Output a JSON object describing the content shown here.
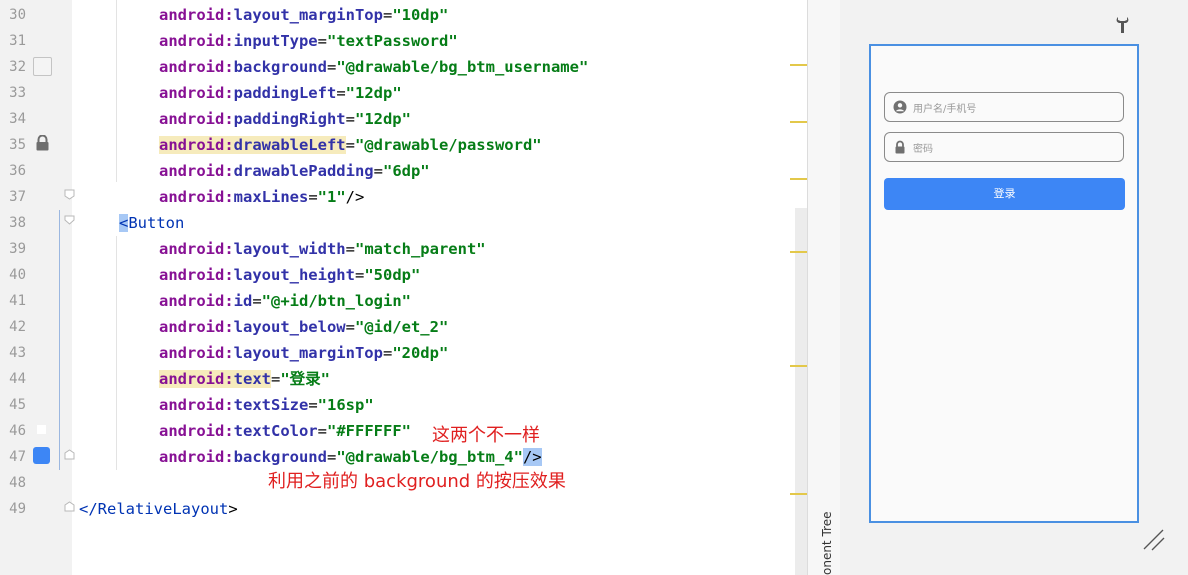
{
  "editor": {
    "lines": [
      {
        "num": "30",
        "indent": 2,
        "parts": [
          [
            "k",
            "android:"
          ],
          [
            "k2",
            "layout_marginTop"
          ],
          [
            "punc",
            "="
          ],
          [
            "v",
            "\"10dp\""
          ]
        ]
      },
      {
        "num": "31",
        "indent": 2,
        "parts": [
          [
            "k",
            "android:"
          ],
          [
            "k2",
            "inputType"
          ],
          [
            "punc",
            "="
          ],
          [
            "v",
            "\"textPassword\""
          ]
        ]
      },
      {
        "num": "32",
        "indent": 2,
        "parts": [
          [
            "k",
            "android:"
          ],
          [
            "k2",
            "background"
          ],
          [
            "punc",
            "="
          ],
          [
            "v",
            "\"@drawable/bg_btm_username\""
          ]
        ]
      },
      {
        "num": "33",
        "indent": 2,
        "parts": [
          [
            "k",
            "android:"
          ],
          [
            "k2",
            "paddingLeft"
          ],
          [
            "punc",
            "="
          ],
          [
            "v",
            "\"12dp\""
          ]
        ]
      },
      {
        "num": "34",
        "indent": 2,
        "parts": [
          [
            "k",
            "android:"
          ],
          [
            "k2",
            "paddingRight"
          ],
          [
            "punc",
            "="
          ],
          [
            "v",
            "\"12dp\""
          ]
        ]
      },
      {
        "num": "35",
        "indent": 2,
        "hl": true,
        "parts": [
          [
            "k",
            "android:"
          ],
          [
            "k2",
            "drawableLeft"
          ],
          [
            "punc",
            "="
          ],
          [
            "v",
            "\"@drawable/password\""
          ]
        ]
      },
      {
        "num": "36",
        "indent": 2,
        "parts": [
          [
            "k",
            "android:"
          ],
          [
            "k2",
            "drawablePadding"
          ],
          [
            "punc",
            "="
          ],
          [
            "v",
            "\"6dp\""
          ]
        ]
      },
      {
        "num": "37",
        "indent": 2,
        "parts": [
          [
            "k",
            "android:"
          ],
          [
            "k2",
            "maxLines"
          ],
          [
            "punc",
            "="
          ],
          [
            "v",
            "\"1\""
          ],
          [
            "punc",
            "/>"
          ]
        ]
      },
      {
        "num": "38",
        "indent": 1,
        "parts": [
          [
            "tag",
            "<Button"
          ]
        ]
      },
      {
        "num": "39",
        "indent": 2,
        "parts": [
          [
            "k",
            "android:"
          ],
          [
            "k2",
            "layout_width"
          ],
          [
            "punc",
            "="
          ],
          [
            "v",
            "\"match_parent\""
          ]
        ]
      },
      {
        "num": "40",
        "indent": 2,
        "parts": [
          [
            "k",
            "android:"
          ],
          [
            "k2",
            "layout_height"
          ],
          [
            "punc",
            "="
          ],
          [
            "v",
            "\"50dp\""
          ]
        ]
      },
      {
        "num": "41",
        "indent": 2,
        "parts": [
          [
            "k",
            "android:"
          ],
          [
            "k2",
            "id"
          ],
          [
            "punc",
            "="
          ],
          [
            "v",
            "\"@+id/btn_login\""
          ]
        ]
      },
      {
        "num": "42",
        "indent": 2,
        "parts": [
          [
            "k",
            "android:"
          ],
          [
            "k2",
            "layout_below"
          ],
          [
            "punc",
            "="
          ],
          [
            "v",
            "\"@id/et_2\""
          ]
        ]
      },
      {
        "num": "43",
        "indent": 2,
        "parts": [
          [
            "k",
            "android:"
          ],
          [
            "k2",
            "layout_marginTop"
          ],
          [
            "punc",
            "="
          ],
          [
            "v",
            "\"20dp\""
          ]
        ]
      },
      {
        "num": "44",
        "indent": 2,
        "hl": true,
        "parts": [
          [
            "k",
            "android:"
          ],
          [
            "k2",
            "text"
          ],
          [
            "punc",
            "="
          ],
          [
            "v",
            "\"登录\""
          ]
        ]
      },
      {
        "num": "45",
        "indent": 2,
        "parts": [
          [
            "k",
            "android:"
          ],
          [
            "k2",
            "textSize"
          ],
          [
            "punc",
            "="
          ],
          [
            "v",
            "\"16sp\""
          ]
        ]
      },
      {
        "num": "46",
        "indent": 2,
        "parts": [
          [
            "k",
            "android:"
          ],
          [
            "k2",
            "textColor"
          ],
          [
            "punc",
            "="
          ],
          [
            "v",
            "\"#FFFFFF\""
          ]
        ]
      },
      {
        "num": "47",
        "indent": 2,
        "parts": [
          [
            "k",
            "android:"
          ],
          [
            "k2",
            "background"
          ],
          [
            "punc",
            "="
          ],
          [
            "v",
            "\"@drawable/bg_btm_4\""
          ],
          [
            "punc",
            "/>"
          ]
        ]
      },
      {
        "num": "48",
        "indent": 0,
        "parts": []
      },
      {
        "num": "49",
        "indent": 0,
        "parts": [
          [
            "tag",
            "</RelativeLayout"
          ],
          [
            "punc",
            ">"
          ]
        ]
      }
    ]
  },
  "annotations": {
    "note1": "这两个不一样",
    "note2": "利用之前的 background 的按压效果"
  },
  "side_panel": {
    "label": "onent Tree"
  },
  "preview": {
    "username_hint": "用户名/手机号",
    "password_hint": "密码",
    "login_label": "登录"
  },
  "colors": {
    "accent": "#3d86f5",
    "annotation": "#e02020",
    "attr_highlight": "#f6ebbc"
  },
  "icons": {
    "lock_gutter": "lock-icon",
    "wrench": "wrench-icon",
    "user": "user-icon",
    "lock_field": "lock-icon",
    "resize": "resize-handle-icon"
  }
}
